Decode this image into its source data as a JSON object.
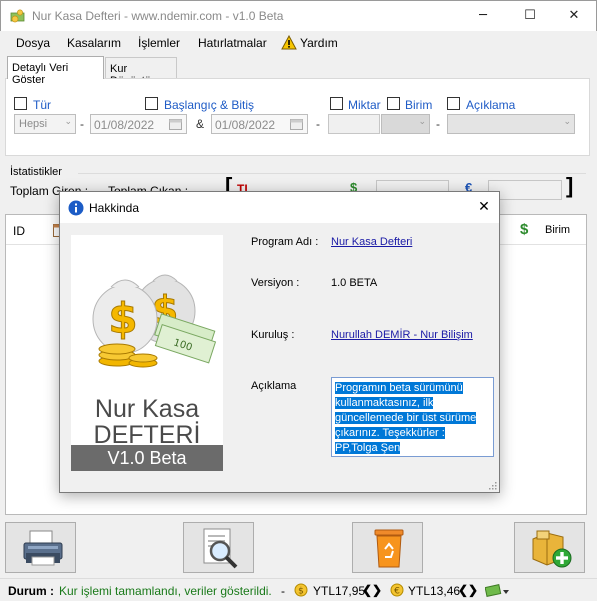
{
  "window": {
    "title": "Nur Kasa Defteri  -  www.ndemir.com  -  v1.0 Beta",
    "minimize": "─",
    "maximize": "☐",
    "close": "✕"
  },
  "menu": [
    "Dosya",
    "Kasalarım",
    "İşlemler",
    "Hatırlatmalar",
    "Yardım"
  ],
  "tabs": [
    "Detaylı Veri Göster",
    "Kur Dönüştür"
  ],
  "filters": {
    "tur_label": "Tür",
    "tur_value": "Hepsi",
    "date_label": "Başlangıç & Bitiş",
    "start_date": "01/08/2022",
    "amp": "&",
    "end_date": "01/08/2022",
    "miktar_label": "Miktar",
    "birim_label": "Birim",
    "aciklama_label": "Açıklama",
    "dash": "-"
  },
  "stats": {
    "section_label": "İstatistikler",
    "toplam_giren": "Toplam Giren :",
    "toplam_cikan": "Toplam Çıkan :",
    "tl_symbol": "TL",
    "usd_symbol": "$",
    "eur_symbol": "€",
    "bracket_open": "[",
    "bracket_close": "]"
  },
  "grid": {
    "col_id": "ID",
    "col_birim": "Birim",
    "usd_symbol": "$"
  },
  "dialog": {
    "title": "Hakkinda",
    "close": "✕",
    "info_glyph": "i",
    "program_adi_label": "Program Adı :",
    "program_adi_value": "Nur Kasa Defteri",
    "versiyon_label": "Versiyon :",
    "versiyon_value": "1.0 BETA",
    "kurulus_label": "Kuruluş :",
    "kurulus_value": "Nurullah DEMİR - Nur Bilişim",
    "aciklama_label": "Açıklama",
    "aciklama_value": "Programın beta sürümünü kullanmaktasınız, ilk güncellemede bir üst sürüme çıkarınız. Teşekkürler : PP,Tolga Şen",
    "logo_line1": "Nur Kasa",
    "logo_line2": "DEFTERİ",
    "logo_version": "V1.0 Beta"
  },
  "status": {
    "label": "Durum :",
    "message": "Kur işlemi tamamlandı, veriler gösterildi.",
    "dash": "-",
    "usd_rate": "YTL17,95",
    "eur_rate": "YTL13,46",
    "arrows": "❮❯"
  },
  "colors": {
    "link": "#1a1aa6",
    "status_green": "#1a7a1a",
    "selection": "#0078d7",
    "bracket_red": "#c00000",
    "dollar_green": "#2c8a2c",
    "euro_blue": "#1d54b8"
  }
}
